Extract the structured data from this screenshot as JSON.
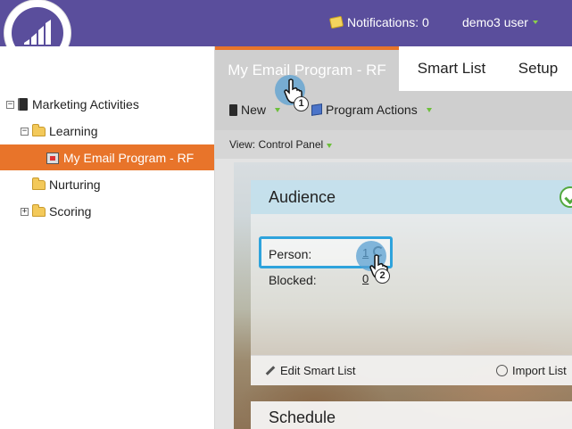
{
  "header": {
    "notifications": "Notifications: 0",
    "user": "demo3 user",
    "accent": "#5a4e9c"
  },
  "tree": {
    "root": "Marketing Activities",
    "items": [
      {
        "label": "Learning"
      },
      {
        "label": "My Email Program - RF"
      },
      {
        "label": "Nurturing"
      },
      {
        "label": "Scoring"
      }
    ],
    "selected_color": "#e8742a"
  },
  "tabs": [
    {
      "label": "My Email Program - RF"
    },
    {
      "label": "Smart List"
    },
    {
      "label": "Setup"
    }
  ],
  "toolbar": {
    "new_label": "New",
    "program_actions_label": "Program Actions"
  },
  "view": {
    "label": "View: Control Panel"
  },
  "audience": {
    "title": "Audience",
    "person_label": "Person:",
    "person_value": "1",
    "blocked_label": "Blocked:",
    "blocked_value": "0",
    "edit_link": "Edit Smart List",
    "import_link": "Import List"
  },
  "schedule": {
    "title": "Schedule"
  },
  "steps": [
    "1",
    "2"
  ]
}
